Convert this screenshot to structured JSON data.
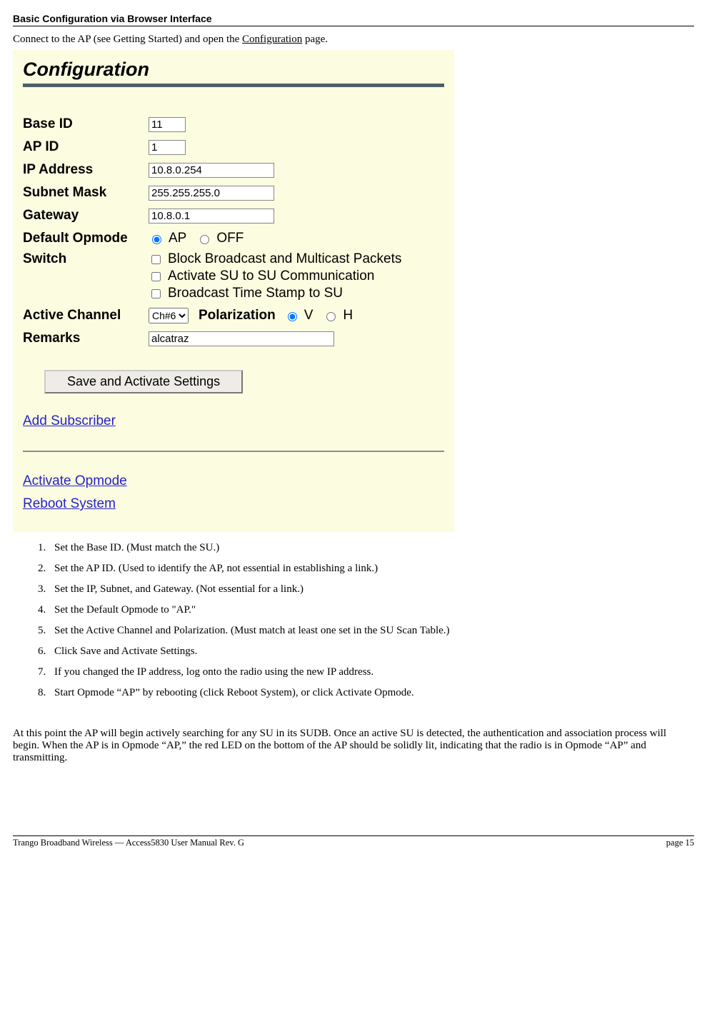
{
  "page_header": "Basic Configuration via Browser Interface",
  "intro_pre": "Connect to the AP (see Getting Started) and open the ",
  "intro_link": "Configuration",
  "intro_post": " page.",
  "screenshot": {
    "title": "Configuration",
    "labels": {
      "base_id": "Base ID",
      "ap_id": "AP ID",
      "ip": "IP Address",
      "subnet": "Subnet Mask",
      "gateway": "Gateway",
      "opmode": "Default Opmode",
      "switch": "Switch",
      "channel": "Active Channel",
      "polarization": "Polarization",
      "remarks": "Remarks"
    },
    "values": {
      "base_id": "11",
      "ap_id": "1",
      "ip": "10.8.0.254",
      "subnet": "255.255.255.0",
      "gateway": "10.8.0.1",
      "channel": "Ch#6",
      "remarks": "alcatraz"
    },
    "opmode_options": {
      "ap": "AP",
      "off": "OFF"
    },
    "switch_options": [
      "Block Broadcast and Multicast Packets",
      "Activate SU to SU Communication",
      "Broadcast Time Stamp to SU"
    ],
    "pol_options": {
      "v": "V",
      "h": "H"
    },
    "save_button": "Save and Activate Settings",
    "links": {
      "add_subscriber": "Add Subscriber",
      "activate_opmode": "Activate Opmode",
      "reboot": "Reboot System"
    }
  },
  "steps": [
    "Set the Base ID.  (Must match the SU.)",
    "Set the AP ID.  (Used to identify the AP, not essential in establishing a link.)",
    "Set the IP, Subnet, and Gateway.  (Not essential for a link.)",
    "Set the Default Opmode to \"AP.\"",
    "Set the Active Channel and Polarization.  (Must match at least one set in the SU Scan Table.)",
    "Click Save and Activate Settings.",
    "If you changed the IP address, log onto the radio using the new IP address.",
    "Start Opmode “AP” by rebooting (click Reboot System), or click Activate Opmode."
  ],
  "after_para": "At this point the AP will begin actively searching for any SU in its SUDB.  Once an active SU is detected, the authentication and association process will begin.  When the AP is in Opmode “AP,” the red LED on the bottom of the AP should be solidly lit, indicating that the radio is in Opmode “AP” and transmitting.",
  "footer_left": "Trango Broadband Wireless — Access5830 User Manual  Rev. G",
  "footer_right": "page 15"
}
